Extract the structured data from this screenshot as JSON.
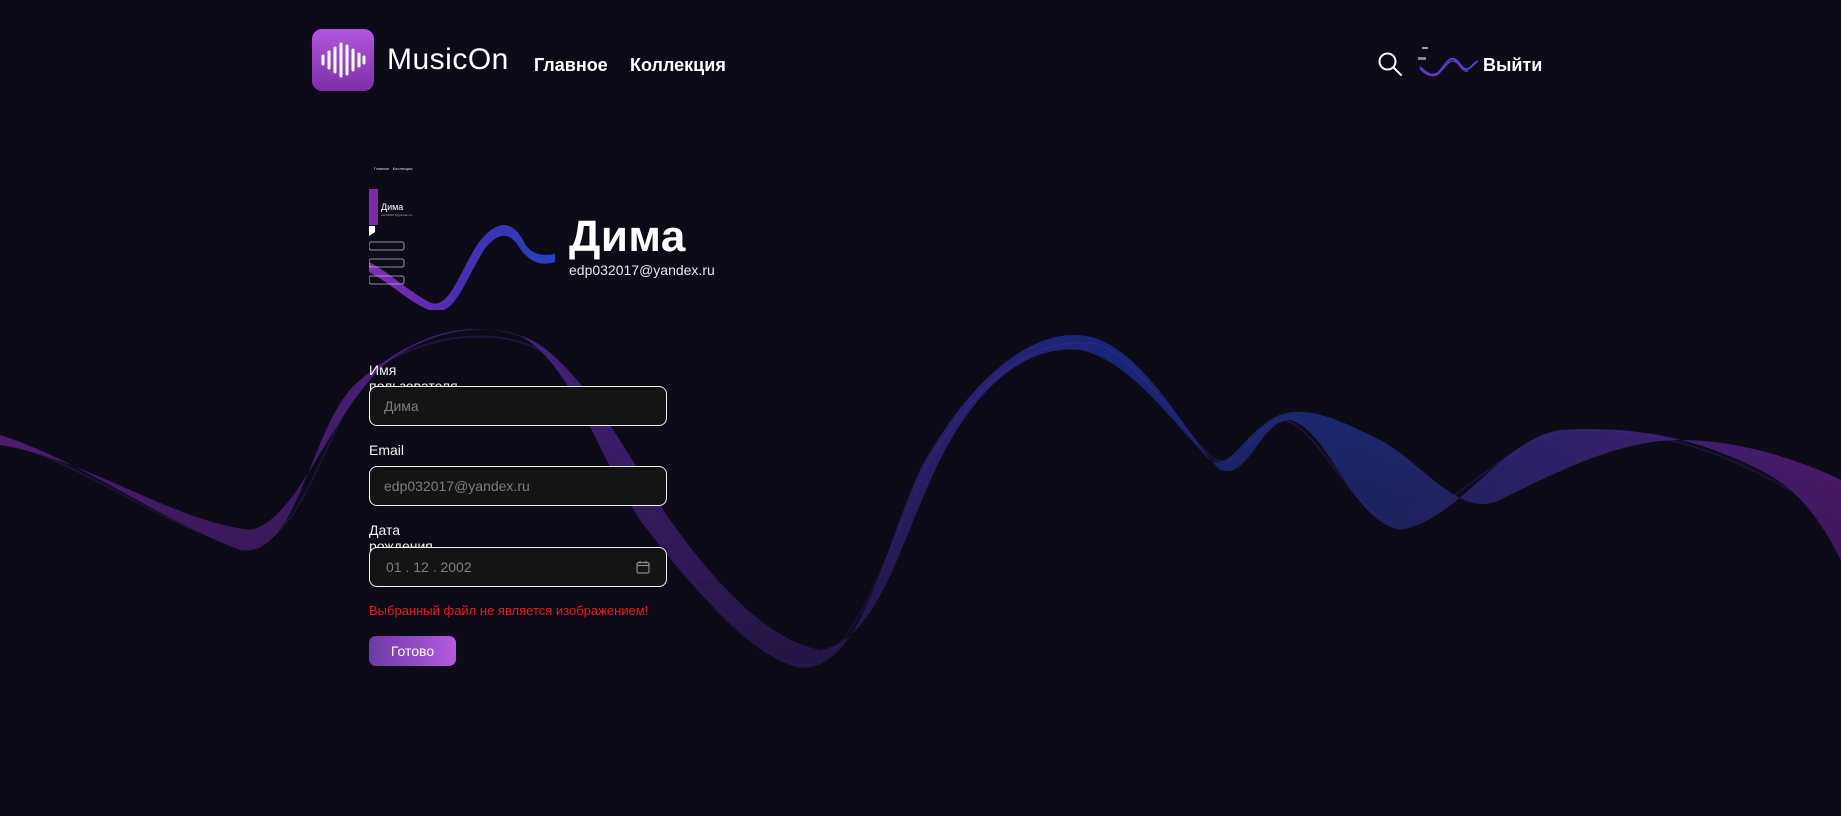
{
  "header": {
    "brand": "MusicOn",
    "nav": {
      "home": "Главное",
      "collection": "Коллекция"
    },
    "logout": "Выйти"
  },
  "icons": {
    "logo": "sound-wave-icon",
    "search": "search-icon",
    "calendar": "calendar-icon"
  },
  "profile": {
    "name": "Дима",
    "email": "edp032017@yandex.ru",
    "preview": {
      "nav_home": "Главное",
      "nav_collection": "Коллекция",
      "name": "Дима",
      "email": "edp032017@yandex.ru"
    }
  },
  "form": {
    "username_label": "Имя пользователя",
    "username_placeholder": "Дима",
    "email_label": "Email",
    "email_placeholder": "edp032017@yandex.ru",
    "birth_label": "Дата рождения",
    "birth_value": "01 . 12 . 2002",
    "error": "Выбранный файл не является изображением!",
    "submit": "Готово"
  },
  "colors": {
    "background": "#0c0b17",
    "accent_purple": "#b257dd",
    "accent_blue": "#2a43c9",
    "error": "#ee1a1a"
  }
}
